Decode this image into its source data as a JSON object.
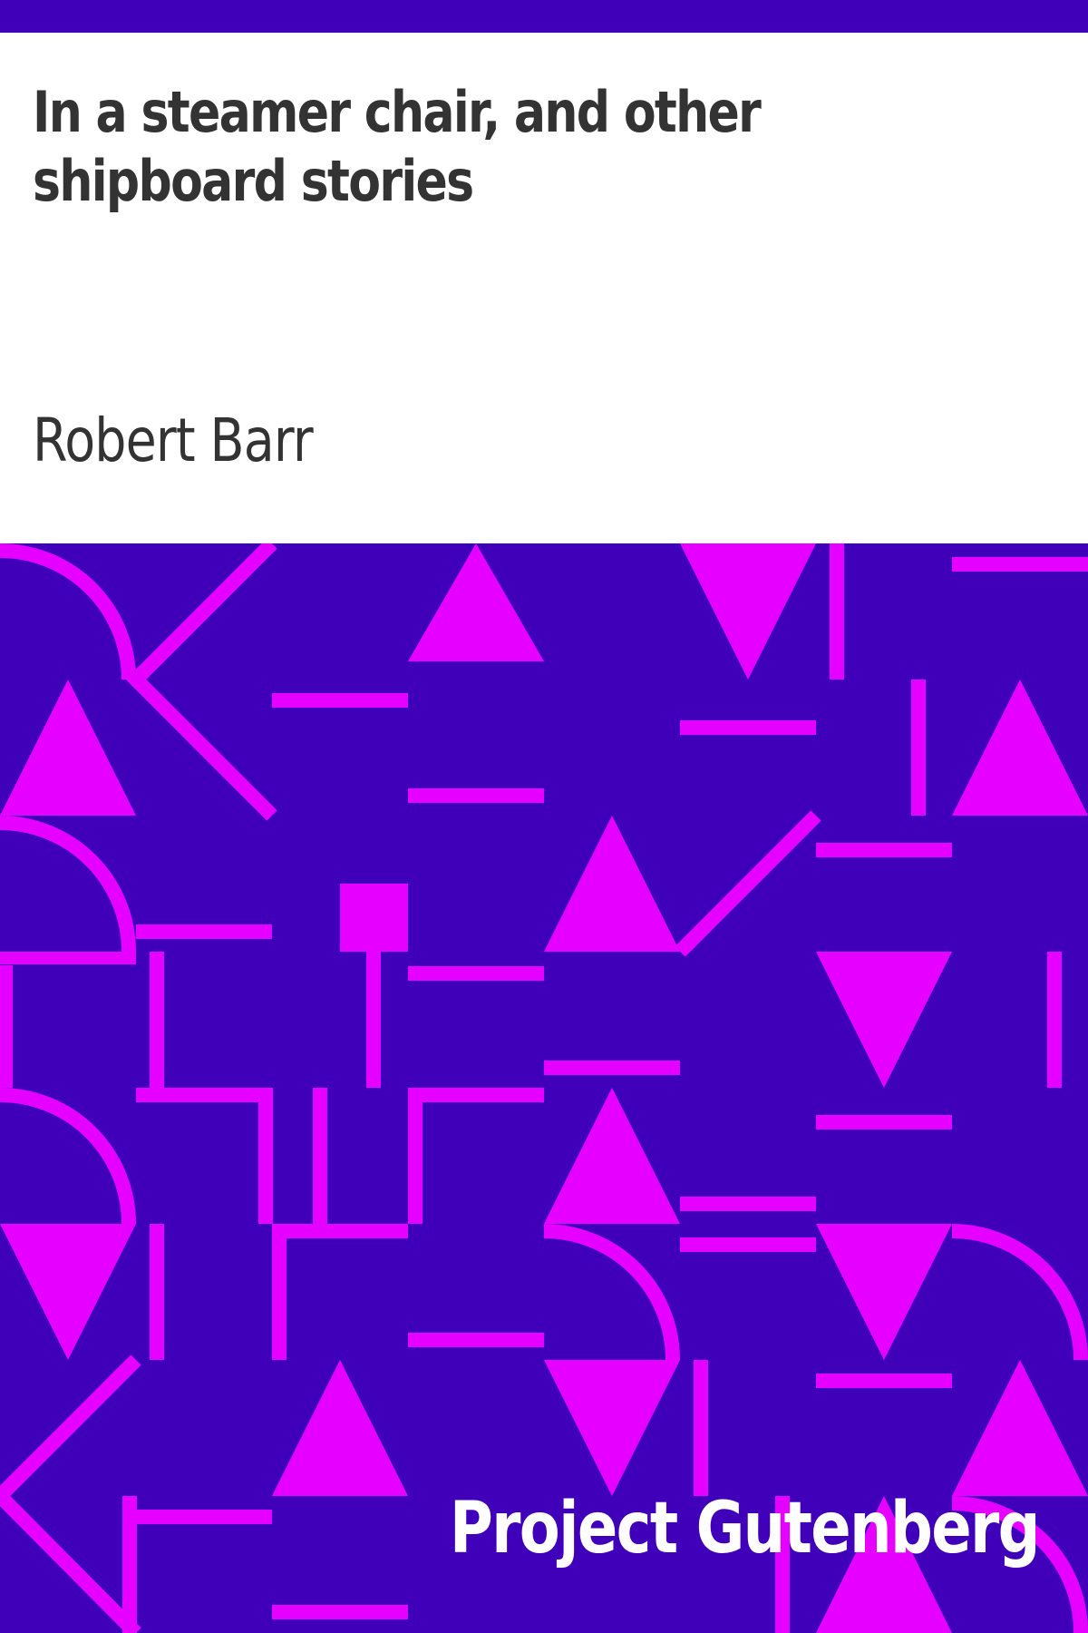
{
  "cover": {
    "title": "In a steamer chair, and other shipboard stories",
    "author": "Robert Barr",
    "publisher": "Project Gutenberg"
  },
  "colors": {
    "background": "#4000b9",
    "pattern": "#e600ff",
    "text_dark": "#333333",
    "text_light": "#ffffff"
  }
}
